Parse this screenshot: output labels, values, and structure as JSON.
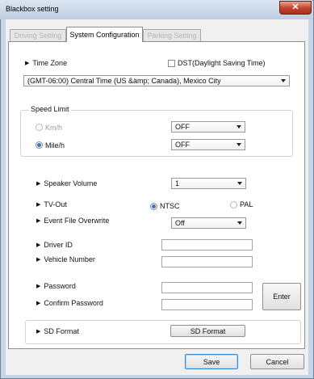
{
  "window": {
    "title": "Blackbox setting",
    "close_glyph": "✕"
  },
  "tabs": [
    {
      "label": "Driving Setting",
      "active": false
    },
    {
      "label": "System Configuration",
      "active": true
    },
    {
      "label": "Parking Setting",
      "active": false
    }
  ],
  "time_zone": {
    "label": "Time Zone",
    "dst_label": "DST(Daylight Saving Time)",
    "dst_checked": false,
    "selected": "(GMT-06:00) Central Time (US &amp; Canada), Mexico City"
  },
  "speed_limit": {
    "legend": "Speed Limit",
    "kmh_label": "Km/h",
    "kmh_value": "OFF",
    "mileh_label": "Mile/h",
    "mileh_value": "OFF",
    "selected_unit": "Mile/h"
  },
  "speaker_volume": {
    "label": "Speaker Volume",
    "value": "1"
  },
  "tv_out": {
    "label": "TV-Out",
    "ntsc_label": "NTSC",
    "pal_label": "PAL",
    "selected": "NTSC"
  },
  "event_file_overwrite": {
    "label": "Event File Overwrite",
    "value": "Off"
  },
  "driver_id": {
    "label": "Driver ID",
    "value": ""
  },
  "vehicle_number": {
    "label": "Vehicle Number",
    "value": ""
  },
  "password": {
    "label": "Password",
    "value": ""
  },
  "confirm_password": {
    "label": "Confirm Password",
    "value": ""
  },
  "enter_button": "Enter",
  "sd_format": {
    "label": "SD Format",
    "button": "SD Format"
  },
  "footer": {
    "save": "Save",
    "cancel": "Cancel"
  },
  "colors": {
    "accent": "#3b73c6",
    "close": "#c1412a",
    "frame": "#c7d6e6"
  }
}
